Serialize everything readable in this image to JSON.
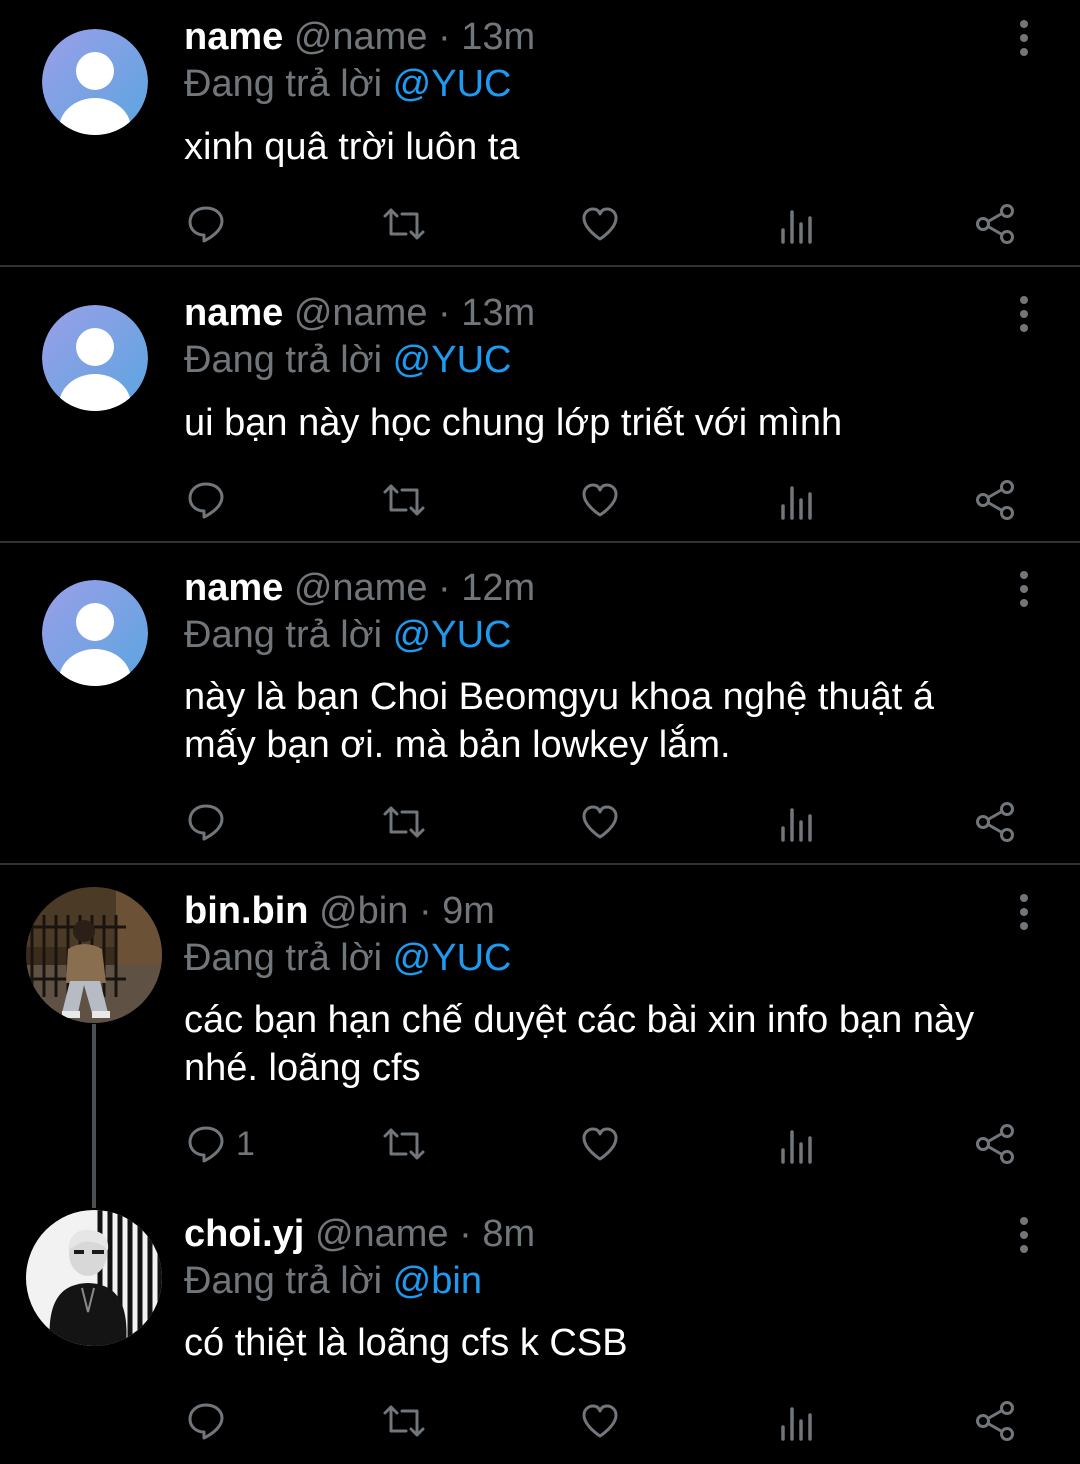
{
  "tweets": [
    {
      "display_name": "name",
      "handle": "@name",
      "separator": "·",
      "time": "13m",
      "reply_prefix": "Đang trả lời",
      "reply_to": "@YUC",
      "lines": [
        "xinh quâ trời luôn ta"
      ],
      "reply_count": "",
      "avatar": "default-profile-icon"
    },
    {
      "display_name": "name",
      "handle": "@name",
      "separator": "·",
      "time": "13m",
      "reply_prefix": "Đang trả lời",
      "reply_to": "@YUC",
      "lines": [
        "ui bạn này học chung lớp triết với mình"
      ],
      "reply_count": "",
      "avatar": "default-profile-icon"
    },
    {
      "display_name": "name",
      "handle": "@name",
      "separator": "·",
      "time": "12m",
      "reply_prefix": "Đang trả lời",
      "reply_to": "@YUC",
      "lines": [
        "này là bạn Choi Beomgyu khoa nghệ thuật á",
        "mấy bạn ơi. mà bản lowkey lắm."
      ],
      "reply_count": "",
      "avatar": "default-profile-icon"
    },
    {
      "display_name": "bin.bin",
      "handle": "@bin",
      "separator": "·",
      "time": "9m",
      "reply_prefix": "Đang trả lời",
      "reply_to": "@YUC",
      "lines": [
        "các bạn hạn chế duyệt các bài xin info bạn này",
        "nhé. loãng cfs"
      ],
      "reply_count": "1",
      "avatar": "user-photo"
    },
    {
      "display_name": "choi.yj",
      "handle": "@name",
      "separator": "·",
      "time": "8m",
      "reply_prefix": "Đang trả lời",
      "reply_to": "@bin",
      "lines": [
        "có thiệt là loãng cfs k CSB"
      ],
      "reply_count": "",
      "avatar": "user-photo-bw"
    }
  ],
  "actions": [
    "reply-icon",
    "retweet-icon",
    "like-icon",
    "views-icon",
    "share-icon"
  ],
  "colors": {
    "background": "#000000",
    "text": "#ffffff",
    "secondary_text": "#71767b",
    "mention": "#1d9bf0",
    "divider": "#2f3336",
    "avatar_gradient_start": "#9b9fe8",
    "avatar_gradient_end": "#5aa5e0"
  }
}
